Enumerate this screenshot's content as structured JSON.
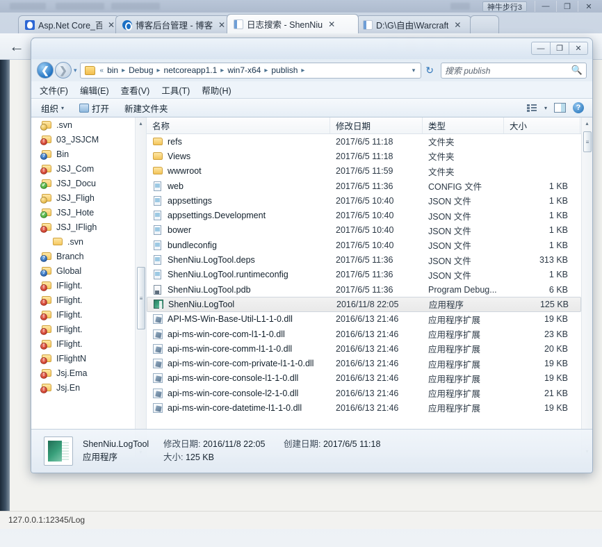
{
  "browser": {
    "window_badge": "神牛步行3",
    "window_controls": [
      "—",
      "❐",
      "✕"
    ],
    "tabs": [
      {
        "label": "Asp.Net Core_百度",
        "favicon": "baidu-favicon",
        "close": "✕",
        "active": false
      },
      {
        "label": "博客后台管理 - 博客",
        "favicon": "blog-favicon",
        "close": "✕",
        "active": false
      },
      {
        "label": "日志搜索 - ShenNiu",
        "favicon": "document-favicon",
        "close": "✕",
        "active": true
      },
      {
        "label": "D:\\G\\自由\\Warcraft",
        "favicon": "document-favicon",
        "close": "✕",
        "active": false
      }
    ],
    "back_icon": "←",
    "status_text": "127.0.0.1:12345/Log"
  },
  "explorer": {
    "window_controls": {
      "minimize": "—",
      "maximize": "❐",
      "close": "✕"
    },
    "nav": {
      "back_icon": "❮",
      "forward_icon": "❯",
      "history_caret_icon": "▾",
      "refresh_icon": "↻"
    },
    "address": {
      "folder_icon": "folder-icon",
      "prefix": "«",
      "crumbs": [
        "bin",
        "Debug",
        "netcoreapp1.1",
        "win7-x64",
        "publish"
      ],
      "separator": "▸",
      "dropdown_icon": "▾"
    },
    "search": {
      "placeholder": "搜索 publish",
      "icon": "search-icon"
    },
    "menu": [
      "文件(F)",
      "编辑(E)",
      "查看(V)",
      "工具(T)",
      "帮助(H)"
    ],
    "toolbar": {
      "organize_label": "组织",
      "organize_caret": "▾",
      "open_label": "打开",
      "new_folder_label": "新建文件夹",
      "view_caret": "▾",
      "view_icon": "view-list-icon",
      "preview_pane_icon": "preview-pane-icon",
      "help_icon": "?"
    },
    "navpane": {
      "scroll_up_icon": "▴",
      "scroll_down_icon": "▾",
      "items": [
        {
          "label": ".svn",
          "badge": "",
          "badge_color": "lock",
          "indent": false
        },
        {
          "label": "03_JSJCM",
          "badge": "!",
          "badge_color": "red",
          "indent": false
        },
        {
          "label": "Bin",
          "badge": "?",
          "badge_color": "blue",
          "indent": false
        },
        {
          "label": "JSJ_Com",
          "badge": "!",
          "badge_color": "red",
          "indent": false
        },
        {
          "label": "JSJ_Docu",
          "badge": "✓",
          "badge_color": "green",
          "indent": false
        },
        {
          "label": "JSJ_Fligh",
          "badge": "",
          "badge_color": "lock",
          "indent": false
        },
        {
          "label": "JSJ_Hote",
          "badge": "✓",
          "badge_color": "green",
          "indent": false
        },
        {
          "label": "JSJ_IFligh",
          "badge": "!",
          "badge_color": "red",
          "indent": false
        },
        {
          "label": ".svn",
          "badge": "",
          "badge_color": "none",
          "indent": true
        },
        {
          "label": "Branch",
          "badge": "?",
          "badge_color": "blue",
          "indent": false
        },
        {
          "label": "Global",
          "badge": "?",
          "badge_color": "blue",
          "indent": false
        },
        {
          "label": "IFlight.",
          "badge": "!",
          "badge_color": "red",
          "indent": false
        },
        {
          "label": "IFlight.",
          "badge": "!",
          "badge_color": "red",
          "indent": false
        },
        {
          "label": "IFlight.",
          "badge": "!",
          "badge_color": "red",
          "indent": false
        },
        {
          "label": "IFlight.",
          "badge": "!",
          "badge_color": "red",
          "indent": false
        },
        {
          "label": "IFlight.",
          "badge": "!",
          "badge_color": "red",
          "indent": false
        },
        {
          "label": "IFlightN",
          "badge": "!",
          "badge_color": "red",
          "indent": false
        },
        {
          "label": "Jsj.Ema",
          "badge": "!",
          "badge_color": "red",
          "indent": false
        },
        {
          "label": "Jsj.En",
          "badge": "!",
          "badge_color": "red",
          "indent": false
        }
      ]
    },
    "list": {
      "columns": [
        "名称",
        "修改日期",
        "类型",
        "大小"
      ],
      "scroll_up_icon": "▴",
      "scroll_down_icon": "▾",
      "rows": [
        {
          "name": "refs",
          "icon": "folder-icon",
          "date": "2017/6/5 11:18",
          "type": "文件夹",
          "size": "",
          "selected": false
        },
        {
          "name": "Views",
          "icon": "folder-icon",
          "date": "2017/6/5 11:18",
          "type": "文件夹",
          "size": "",
          "selected": false
        },
        {
          "name": "wwwroot",
          "icon": "folder-icon",
          "date": "2017/6/5 11:59",
          "type": "文件夹",
          "size": "",
          "selected": false
        },
        {
          "name": "web",
          "icon": "doc-icon",
          "date": "2017/6/5 11:36",
          "type": "CONFIG 文件",
          "size": "1 KB",
          "selected": false
        },
        {
          "name": "appsettings",
          "icon": "doc-icon",
          "date": "2017/6/5 10:40",
          "type": "JSON 文件",
          "size": "1 KB",
          "selected": false
        },
        {
          "name": "appsettings.Development",
          "icon": "doc-icon",
          "date": "2017/6/5 10:40",
          "type": "JSON 文件",
          "size": "1 KB",
          "selected": false
        },
        {
          "name": "bower",
          "icon": "doc-icon",
          "date": "2017/6/5 10:40",
          "type": "JSON 文件",
          "size": "1 KB",
          "selected": false
        },
        {
          "name": "bundleconfig",
          "icon": "doc-icon",
          "date": "2017/6/5 10:40",
          "type": "JSON 文件",
          "size": "1 KB",
          "selected": false
        },
        {
          "name": "ShenNiu.LogTool.deps",
          "icon": "doc-icon",
          "date": "2017/6/5 11:36",
          "type": "JSON 文件",
          "size": "313 KB",
          "selected": false
        },
        {
          "name": "ShenNiu.LogTool.runtimeconfig",
          "icon": "doc-icon",
          "date": "2017/6/5 11:36",
          "type": "JSON 文件",
          "size": "1 KB",
          "selected": false
        },
        {
          "name": "ShenNiu.LogTool.pdb",
          "icon": "pdb-icon",
          "date": "2017/6/5 11:36",
          "type": "Program Debug...",
          "size": "6 KB",
          "selected": false
        },
        {
          "name": "ShenNiu.LogTool",
          "icon": "exe-icon",
          "date": "2016/11/8 22:05",
          "type": "应用程序",
          "size": "125 KB",
          "selected": true
        },
        {
          "name": "API-MS-Win-Base-Util-L1-1-0.dll",
          "icon": "dll-icon",
          "date": "2016/6/13 21:46",
          "type": "应用程序扩展",
          "size": "19 KB",
          "selected": false
        },
        {
          "name": "api-ms-win-core-com-l1-1-0.dll",
          "icon": "dll-icon",
          "date": "2016/6/13 21:46",
          "type": "应用程序扩展",
          "size": "23 KB",
          "selected": false
        },
        {
          "name": "api-ms-win-core-comm-l1-1-0.dll",
          "icon": "dll-icon",
          "date": "2016/6/13 21:46",
          "type": "应用程序扩展",
          "size": "20 KB",
          "selected": false
        },
        {
          "name": "api-ms-win-core-com-private-l1-1-0.dll",
          "icon": "dll-icon",
          "date": "2016/6/13 21:46",
          "type": "应用程序扩展",
          "size": "19 KB",
          "selected": false
        },
        {
          "name": "api-ms-win-core-console-l1-1-0.dll",
          "icon": "dll-icon",
          "date": "2016/6/13 21:46",
          "type": "应用程序扩展",
          "size": "19 KB",
          "selected": false
        },
        {
          "name": "api-ms-win-core-console-l2-1-0.dll",
          "icon": "dll-icon",
          "date": "2016/6/13 21:46",
          "type": "应用程序扩展",
          "size": "21 KB",
          "selected": false
        },
        {
          "name": "api-ms-win-core-datetime-l1-1-0.dll",
          "icon": "dll-icon",
          "date": "2016/6/13 21:46",
          "type": "应用程序扩展",
          "size": "19 KB",
          "selected": false
        }
      ]
    },
    "details": {
      "icon": "application-thumbnail",
      "file_name": "ShenNiu.LogTool",
      "modified_label": "修改日期:",
      "modified_value": "2016/11/8 22:05",
      "created_label": "创建日期:",
      "created_value": "2017/6/5 11:18",
      "type_value": "应用程序",
      "size_label": "大小:",
      "size_value": "125 KB"
    }
  }
}
